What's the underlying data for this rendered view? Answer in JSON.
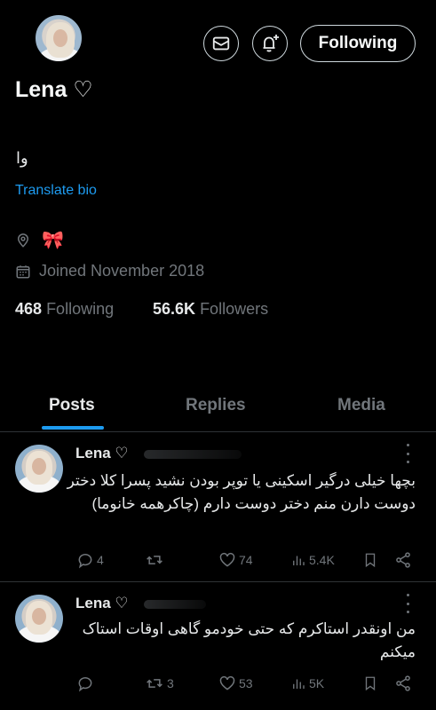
{
  "header": {
    "following_label": "Following"
  },
  "profile": {
    "display_name": "Lena ♡",
    "bio": "وا",
    "translate_label": "Translate bio",
    "location_emoji": "🎀",
    "joined": "Joined November 2018",
    "following_count": "468",
    "following_label": "Following",
    "followers_count": "56.6K",
    "followers_label": "Followers"
  },
  "tabs": [
    {
      "label": "Posts",
      "active": true
    },
    {
      "label": "Replies",
      "active": false
    },
    {
      "label": "Media",
      "active": false
    }
  ],
  "posts": [
    {
      "author": "Lena ♡",
      "text": "بچها خیلی درگیر اسکینی یا توپر بودن نشید پسرا کلا دختر دوست دارن منم دختر دوست دارم (چاکرهمه خانوما)",
      "replies": "4",
      "reposts": "",
      "likes": "74",
      "views": "5.4K"
    },
    {
      "author": "Lena ♡",
      "text": "من اونقدر استاکرم که حتی خودمو گاهی اوقات استاک میکنم",
      "replies": "",
      "reposts": "3",
      "likes": "53",
      "views": "5K"
    }
  ],
  "colors": {
    "background": "#000000",
    "accent": "#1d9bf0",
    "muted": "#71767b",
    "text": "#e7e9ea"
  }
}
